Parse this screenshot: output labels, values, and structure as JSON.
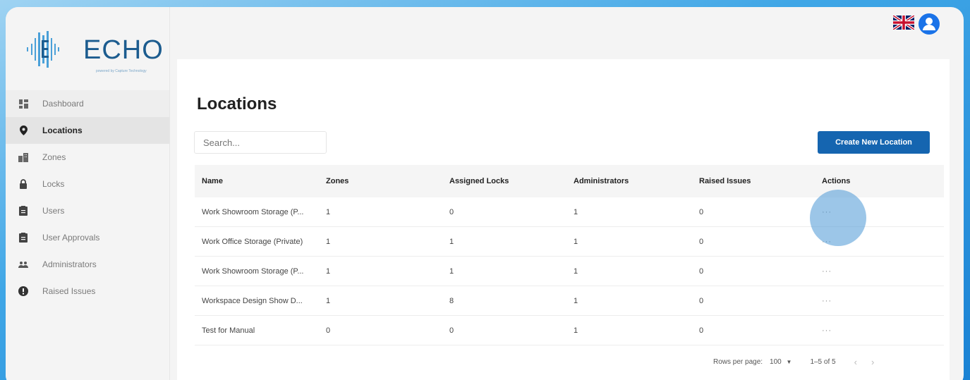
{
  "brand": {
    "name": "ECHO",
    "tagline": "powered by Capture Technology"
  },
  "sidebar": {
    "items": [
      {
        "label": "Dashboard",
        "icon": "dashboard-icon"
      },
      {
        "label": "Locations",
        "icon": "location-pin-icon"
      },
      {
        "label": "Zones",
        "icon": "buildings-icon"
      },
      {
        "label": "Locks",
        "icon": "lock-icon"
      },
      {
        "label": "Users",
        "icon": "clipboard-icon"
      },
      {
        "label": "User Approvals",
        "icon": "clipboard-check-icon"
      },
      {
        "label": "Administrators",
        "icon": "people-icon"
      },
      {
        "label": "Raised Issues",
        "icon": "alert-icon"
      }
    ],
    "active": "Locations"
  },
  "header": {
    "language_flag": "uk-flag-icon",
    "account_icon": "user-avatar-icon"
  },
  "main": {
    "title": "Locations",
    "search_placeholder": "Search...",
    "create_button": "Create New Location",
    "table": {
      "columns": [
        "Name",
        "Zones",
        "Assigned Locks",
        "Administrators",
        "Raised Issues",
        "Actions"
      ],
      "rows": [
        {
          "name": "Work Showroom Storage (P...",
          "zones": "1",
          "locks": "0",
          "admins": "1",
          "issues": "0",
          "actions": "···"
        },
        {
          "name": "Work Office Storage (Private)",
          "zones": "1",
          "locks": "1",
          "admins": "1",
          "issues": "0",
          "actions": "···"
        },
        {
          "name": "Work Showroom Storage (P...",
          "zones": "1",
          "locks": "1",
          "admins": "1",
          "issues": "0",
          "actions": "···"
        },
        {
          "name": "Workspace Design Show D...",
          "zones": "1",
          "locks": "8",
          "admins": "1",
          "issues": "0",
          "actions": "···"
        },
        {
          "name": "Test for Manual",
          "zones": "0",
          "locks": "0",
          "admins": "1",
          "issues": "0",
          "actions": "···"
        }
      ]
    },
    "pagination": {
      "rows_label": "Rows per page:",
      "rows_value": "100",
      "range": "1–5 of 5"
    }
  },
  "colors": {
    "accent": "#1565b0",
    "background_gradient": "#3fa6e6"
  }
}
